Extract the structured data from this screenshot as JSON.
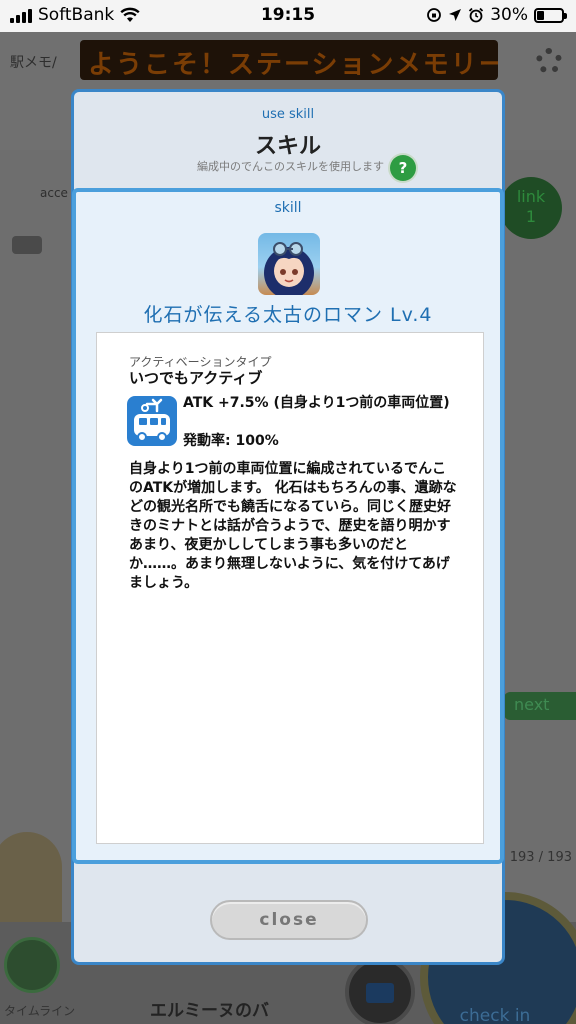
{
  "status_bar": {
    "carrier": "SoftBank",
    "time": "19:15",
    "battery_percent": "30%",
    "battery_level": 0.3
  },
  "background": {
    "marquee": "ようこそ！ステーションメモリー",
    "ekimemo": "駅メモ/",
    "acce_label": "acce",
    "link_label": "link",
    "link_value": "1",
    "next_label": "next",
    "count": "193 / 193",
    "checkin_label": "check in",
    "timeline_label": "タイムライン",
    "eru_label": "エルミーヌのバ"
  },
  "dialog": {
    "subtitle": "use skill",
    "title": "スキル",
    "description": "編成中のでんこのスキルを使用します",
    "help_label": "?",
    "close_label": "close"
  },
  "skill": {
    "tag": "skill",
    "name": "化石が伝える太古のロマン Lv.4",
    "activation_label": "アクティベーションタイプ",
    "activation_value": "いつでもアクティブ",
    "effect": "ATK +7.5% (自身より1つ前の車両位置)",
    "rate": "発動率: 100%",
    "description": "自身より1つ前の車両位置に編成されているでんこのATKが増加します。 化石はもちろんの事、遺跡などの観光名所でも饒舌になるていら。同じく歴史好きのミナトとは話が合うようで、歴史を語り明かすあまり、夜更かししてしまう事も多いのだとか……。あまり無理しないように、気を付けてあげましょう。"
  },
  "colors": {
    "accent": "#1f6fb2",
    "panel_border": "#4b9fdc",
    "help_green": "#2e9c42"
  },
  "icons": {
    "wifi": "wifi-icon",
    "location": "location-arrow-icon",
    "alarm": "alarm-icon",
    "rotation_lock": "rotation-lock-icon",
    "effect": "train-car-icon",
    "avatar": "denko-avatar-icon"
  }
}
